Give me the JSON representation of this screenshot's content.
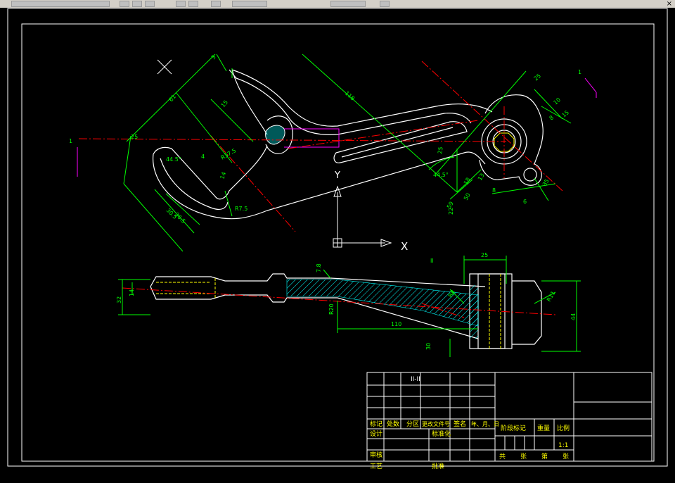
{
  "app": {
    "toolbar_glyphs": [
      "□",
      "◇",
      "○",
      "▤",
      "●",
      "▥"
    ],
    "close_glyph": "×"
  },
  "colors": {
    "background": "#000000",
    "outline": "#ffffff",
    "dimension": "#00ff00",
    "centerline": "#ff0000",
    "construction": "#ff00ff",
    "hatch": "#00ffff",
    "highlight": "#ffff00",
    "ucs": "#ffffff"
  },
  "ucs": {
    "y_label": "Y",
    "x_label": "X"
  },
  "section_mark": "II",
  "dims_top": {
    "d61": "61",
    "d3": "3",
    "d15": "15",
    "d118": "118",
    "d25a": "25",
    "d10": "10",
    "d8": "8",
    "d15b": "15",
    "d49": "44.5°",
    "r": "R7.5",
    "r2": "R37.5",
    "d14": "14",
    "d36": "36.5",
    "d30": "30.5",
    "a44": "44.5°",
    "d4": "4",
    "d25b": "25",
    "d18": "18",
    "d13": "13",
    "d50": "50",
    "d59": "59",
    "d22": "22",
    "d8b": "8",
    "d35": "35",
    "d6": "6",
    "d1": "1",
    "left": "1",
    "d252": "25"
  },
  "dims_side": {
    "d25": "25",
    "d7_8": "7.8",
    "d32": "32",
    "d14": "14",
    "d110": "110",
    "r20": "R20",
    "r8": "R8",
    "r11": "R11",
    "d44": "44",
    "d30": "30"
  },
  "title_block": {
    "section_label": "II-II",
    "labels": {
      "mark": "标记",
      "count": "处数",
      "zone": "分区",
      "doc_no": "更改文件号",
      "sign": "签名",
      "date": "年、月、日",
      "design": "设计",
      "standardize": "标准化",
      "review": "审核",
      "process": "工艺",
      "approve": "批准",
      "stage_mark": "阶段标记",
      "weight": "重量",
      "scale": "比例",
      "scale_value": "1:1",
      "total": "共",
      "sheets": "张",
      "page": "第",
      "sheet": "张"
    }
  }
}
